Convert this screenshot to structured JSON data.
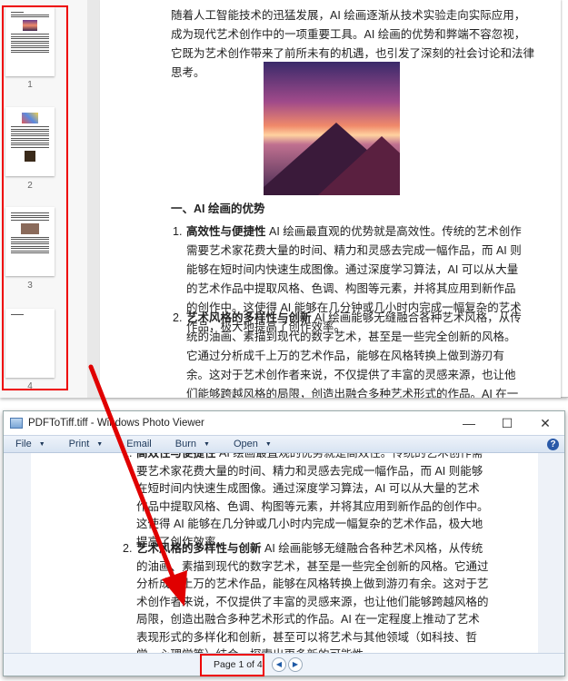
{
  "pdf_viewer": {
    "thumbnails": [
      {
        "label": "1"
      },
      {
        "label": "2"
      },
      {
        "label": "3"
      },
      {
        "label": "4"
      }
    ],
    "intro": "随着人工智能技术的迅猛发展，AI 绘画逐渐从技术实验走向实际应用，成为现代艺术创作中的一项重要工具。AI 绘画的优势和弊端不容忽视，它既为艺术创作带来了前所未有的机遇，也引发了深刻的社会讨论和法律思考。",
    "heading": "一、AI 绘画的优势",
    "items": [
      {
        "num": "1.",
        "title": "高效性与便捷性",
        "text": " AI 绘画最直观的优势就是高效性。传统的艺术创作需要艺术家花费大量的时间、精力和灵感去完成一幅作品，而 AI 则能够在短时间内快速生成图像。通过深度学习算法，AI 可以从大量的艺术作品中提取风格、色调、构图等元素，并将其应用到新作品的创作中。这使得 AI 能够在几分钟或几小时内完成一幅复杂的艺术作品，极大地提高了创作效率。"
      },
      {
        "num": "2.",
        "title": "艺术风格的多样性与创新",
        "text": " AI 绘画能够无缝融合各种艺术风格，从传统的油画、素描到现代的数字艺术，甚至是一些完全创新的风格。它通过分析成千上万的艺术作品，能够在风格转换上做到游刃有余。这对于艺术创作者来说，不仅提供了丰富的灵感来源，也让他们能够跨越风格的局限，创造出融合多种艺术形式的作品。AI 在一定程度上推动了艺术表现形式的多样化和创新，甚至可以将艺术与其他领域（如科技、哲学、心理学等）结合，探索出更多新的可能性。"
      }
    ]
  },
  "photo_viewer": {
    "title": "PDFToTiff.tiff - Windows Photo Viewer",
    "controls": {
      "minimize": "—",
      "maximize": "☐",
      "close": "✕"
    },
    "toolbar": [
      {
        "label": "File"
      },
      {
        "label": "Print"
      },
      {
        "label": "Email"
      },
      {
        "label": "Burn"
      },
      {
        "label": "Open"
      }
    ],
    "help": "?",
    "page_status": "Page 1 of 4",
    "prev": "◀",
    "next": "▶"
  },
  "annotation_color": "#e00000"
}
